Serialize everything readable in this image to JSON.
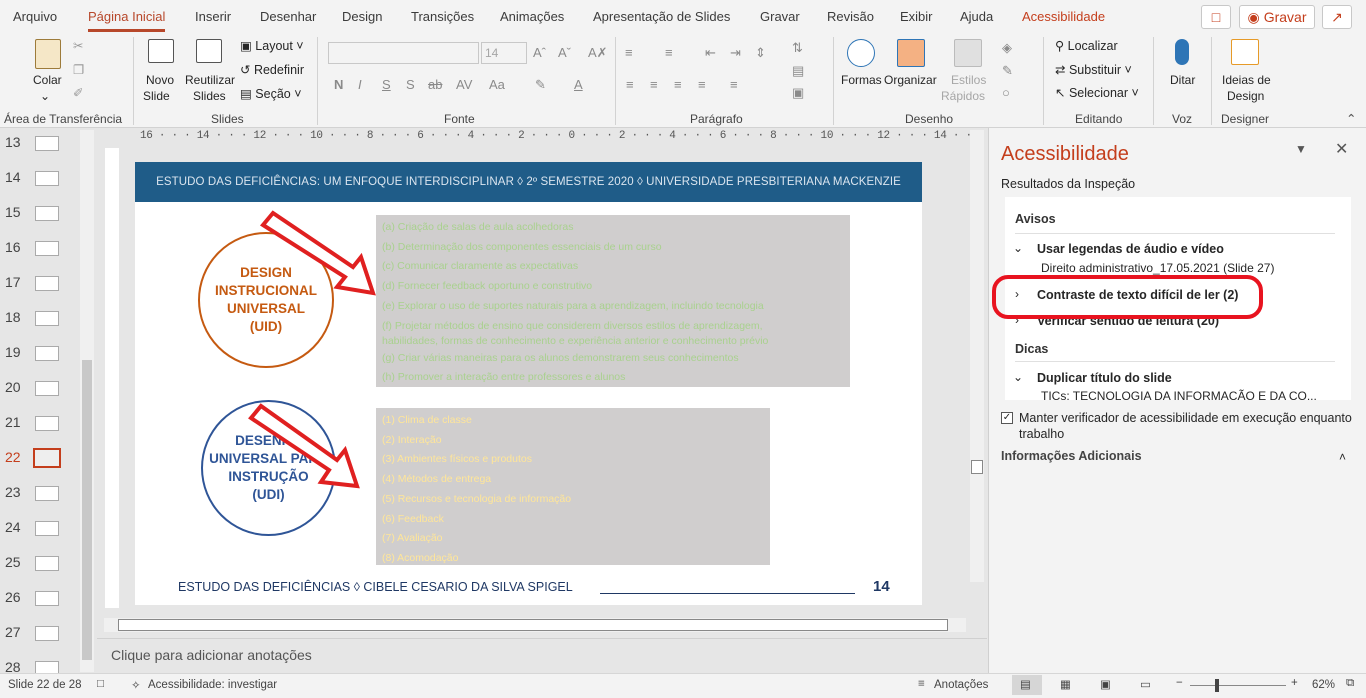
{
  "menu": {
    "tabs": [
      "Arquivo",
      "Página Inicial",
      "Inserir",
      "Desenhar",
      "Design",
      "Transições",
      "Animações",
      "Apresentação de Slides",
      "Gravar",
      "Revisão",
      "Exibir",
      "Ajuda",
      "Acessibilidade"
    ],
    "record_label": "Gravar"
  },
  "ribbon": {
    "clipboard": {
      "paste": "Colar",
      "label": "Área de Transferência"
    },
    "slides": {
      "new_slide_1": "Novo",
      "new_slide_2": "Slide",
      "reuse_1": "Reutilizar",
      "reuse_2": "Slides",
      "layout": "Layout",
      "reset": "Redefinir",
      "section": "Seção",
      "label": "Slides"
    },
    "font": {
      "size": "14",
      "label": "Fonte"
    },
    "paragraph": {
      "label": "Parágrafo"
    },
    "drawing": {
      "shapes": "Formas",
      "arrange": "Organizar",
      "quick_1": "Estilos",
      "quick_2": "Rápidos",
      "label": "Desenho"
    },
    "editing": {
      "find": "Localizar",
      "replace": "Substituir",
      "select": "Selecionar",
      "label": "Editando"
    },
    "voice": {
      "dictate": "Ditar",
      "label": "Voz"
    },
    "designer": {
      "ideas_1": "Ideias de",
      "ideas_2": "Design",
      "label": "Designer"
    }
  },
  "thumbnails": {
    "numbers": [
      "13",
      "14",
      "15",
      "16",
      "17",
      "18",
      "19",
      "20",
      "21",
      "22",
      "23",
      "24",
      "25",
      "26",
      "27",
      "28"
    ],
    "selected": "22"
  },
  "ruler": {
    "text": "16 · · · 14 · · · 12 · · · 10 · · · 8 · · · 6 · · · 4 · · · 2 · · · 0 · · · 2 · · · 4 · · · 6 · · · 8 · · · 10 · · · 12 · · · 14 · · · 16"
  },
  "slide": {
    "header": "ESTUDO DAS DEFICIÊNCIAS: UM ENFOQUE INTERDISCIPLINAR  ◊  2º SEMESTRE 2020  ◊  UNIVERSIDADE PRESBITERIANA MACKENZIE",
    "circle1": {
      "l1": "DESIGN",
      "l2": "INSTRUCIONAL",
      "l3": "UNIVERSAL",
      "l4": "(UID)"
    },
    "circle2": {
      "l1": "DESENHO",
      "l2": "UNIVERSAL PARA",
      "l3": "INSTRUÇÃO",
      "l4": "(UDI)"
    },
    "list1": [
      "(a) Criação de salas de aula acolhedoras",
      "(b) Determinação dos componentes essenciais de um curso",
      "(c) Comunicar claramente as expectativas",
      "(d) Fornecer feedback oportuno e construtivo",
      "(e) Explorar o uso de suportes naturais para a aprendizagem, incluindo tecnologia",
      "(f) Projetar métodos de ensino que considerem diversos estilos de aprendizagem,",
      "habilidades, formas de conhecimento e experiência anterior e conhecimento prévio",
      "(g) Criar várias maneiras para os alunos demonstrarem seus conhecimentos",
      "(h) Promover a interação entre professores e alunos"
    ],
    "list2": [
      "(1) Clima de classe",
      "(2) Interação",
      "(3) Ambientes físicos e produtos",
      "(4) Métodos de entrega",
      "(5) Recursos e tecnologia de informação",
      "(6) Feedback",
      "(7) Avaliação",
      "(8) Acomodação"
    ],
    "footer": "ESTUDO DAS DEFICIÊNCIAS ◊  CIBELE CESARIO DA SILVA SPIGEL",
    "page_number": "14"
  },
  "notes_placeholder": "Clique para adicionar anotações",
  "pane": {
    "title": "Acessibilidade",
    "subtitle": "Resultados da Inspeção",
    "warnings_header": "Avisos",
    "item1": "Usar legendas de áudio e vídeo",
    "item1_sub": "Direito administrativo_17.05.2021  (Slide 27)",
    "item2": "Contraste de texto difícil de ler (2)",
    "item3": "Verificar sentido de leitura (20)",
    "tips_header": "Dicas",
    "item4": "Duplicar título do slide",
    "item4_sub": "TICs: TECNOLOGIA DA INFORMAÇÃO E DA CO...",
    "keep_running_1": "Manter verificador de acessibilidade em execução enquanto",
    "keep_running_2": "trabalho",
    "more_info": "Informações Adicionais"
  },
  "status": {
    "slide": "Slide 22 de 28",
    "accessibility": "Acessibilidade: investigar",
    "notes": "Anotações",
    "zoom": "62%"
  }
}
